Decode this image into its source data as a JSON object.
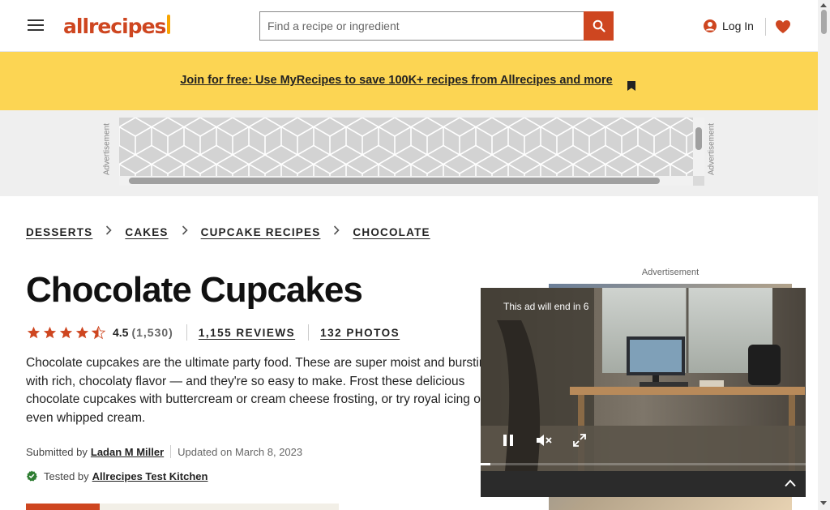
{
  "header": {
    "logo_text": "allrecipes",
    "search": {
      "placeholder": "Find a recipe or ingredient"
    },
    "login_label": "Log In"
  },
  "banner": {
    "text": "Join for free: Use MyRecipes to save 100K+ recipes from Allrecipes and more"
  },
  "ads": {
    "label": "Advertisement"
  },
  "breadcrumb": {
    "items": [
      "DESSERTS",
      "CAKES",
      "CUPCAKE RECIPES",
      "CHOCOLATE"
    ]
  },
  "recipe": {
    "title": "Chocolate Cupcakes",
    "rating": 4.5,
    "rating_value": "4.5",
    "rating_count": "(1,530)",
    "reviews": "1,155 REVIEWS",
    "photos": "132 PHOTOS",
    "description": "Chocolate cupcakes are the ultimate party food. These are super moist and bursting with rich, chocolaty flavor — and they're so easy to make. Frost these delicious chocolate cupcakes with buttercream or cream cheese frosting, or try royal icing or even whipped cream.",
    "submitted_prefix": "Submitted by",
    "author": "Ladan M Miller",
    "updated": "Updated on March 8, 2023",
    "tested_prefix": "Tested by",
    "tested_by": "Allrecipes Test Kitchen"
  },
  "video": {
    "countdown": "This ad will end in 6",
    "progress": 0.03
  },
  "colors": {
    "brand": "#ce4620",
    "banner": "#fcd553",
    "star": "#ce4620"
  }
}
